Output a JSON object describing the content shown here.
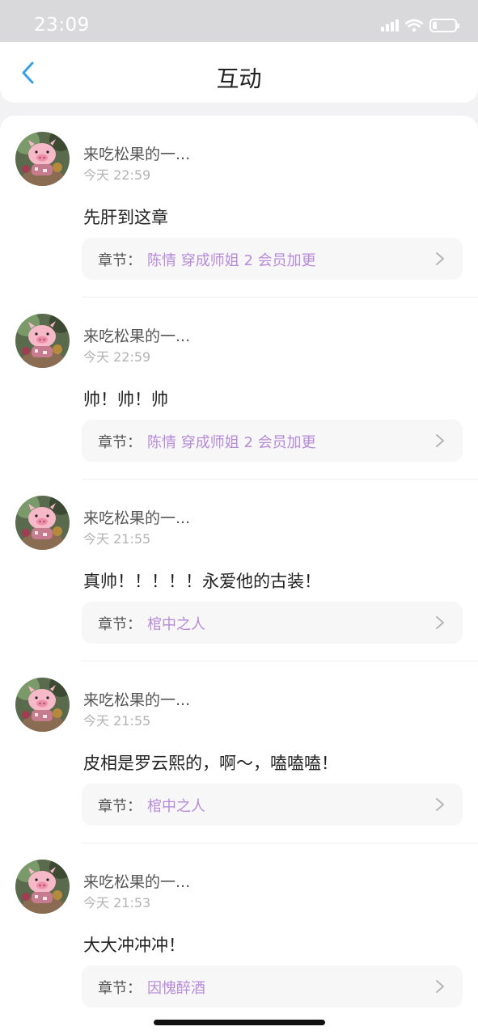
{
  "status_bar": {
    "time": "23:09",
    "battery_level": 0.15
  },
  "header": {
    "title": "互动",
    "back_icon": "chevron-left-icon"
  },
  "comments": [
    {
      "username": "来吃松果的一...",
      "time": "今天 22:59",
      "text": "先肝到这章",
      "chapter_label": "章节：",
      "chapter_title": "陈情 穿成师姐 2 会员加更"
    },
    {
      "username": "来吃松果的一...",
      "time": "今天 22:59",
      "text": "帅！帅！帅",
      "chapter_label": "章节：",
      "chapter_title": "陈情 穿成师姐 2 会员加更"
    },
    {
      "username": "来吃松果的一...",
      "time": "今天 21:55",
      "text": "真帅！！！！！永爱他的古装！",
      "chapter_label": "章节：",
      "chapter_title": "棺中之人"
    },
    {
      "username": "来吃松果的一...",
      "time": "今天 21:55",
      "text": "皮相是罗云熙的，啊～，嗑嗑嗑！",
      "chapter_label": "章节：",
      "chapter_title": "棺中之人"
    },
    {
      "username": "来吃松果的一...",
      "time": "今天 21:53",
      "text": "大大冲冲冲！",
      "chapter_label": "章节：",
      "chapter_title": "因愧醉酒"
    }
  ],
  "colors": {
    "accent": "#3aa0e6",
    "chapter_link": "#b68bd8"
  }
}
